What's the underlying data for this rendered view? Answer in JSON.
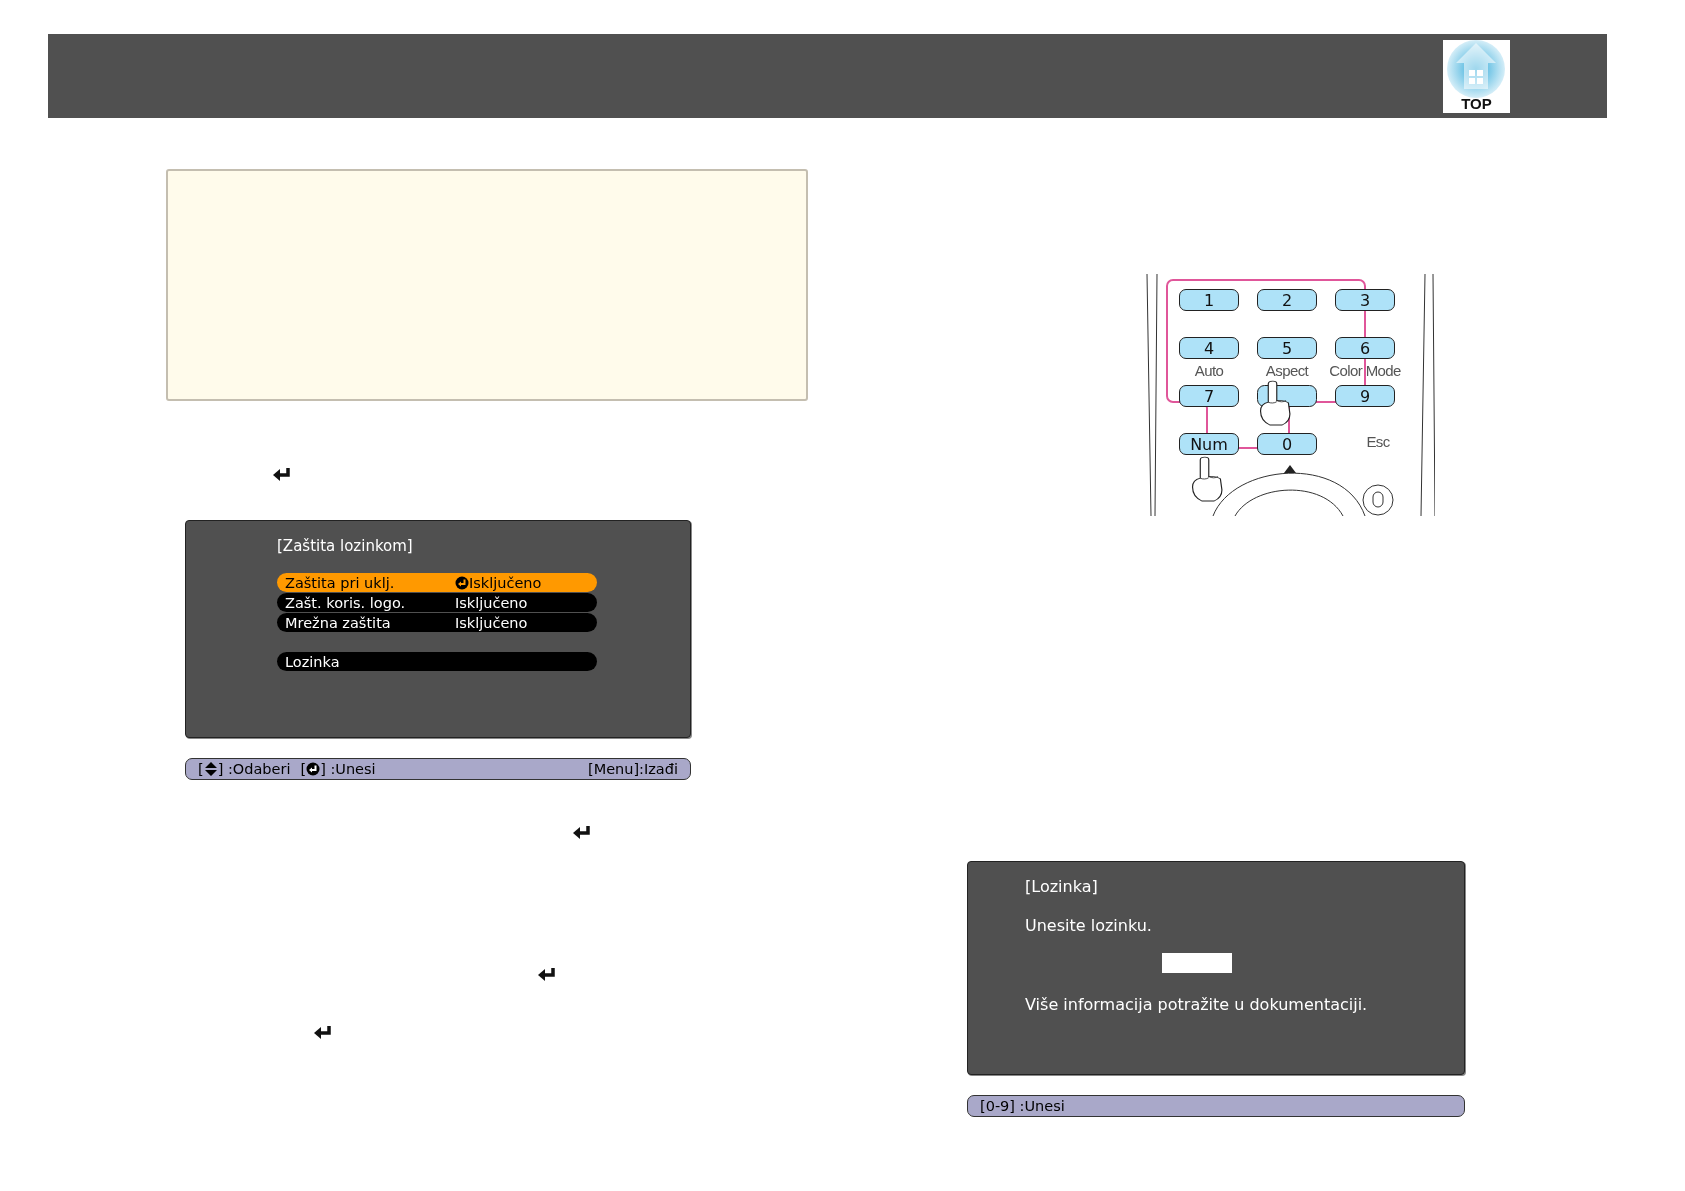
{
  "header": {
    "logo_text": "TOP"
  },
  "menu_screen": {
    "title": "[Zaštita lozinkom]",
    "items": [
      {
        "label": "Zaštita pri uklj.",
        "value": "Isključeno",
        "selected": true
      },
      {
        "label": "Zašt. koris. logo.",
        "value": "Isključeno",
        "selected": false
      },
      {
        "label": "Mrežna zaštita",
        "value": "Isključeno",
        "selected": false
      },
      {
        "label": "Lozinka",
        "selected": false
      }
    ],
    "help_bar": {
      "items": [
        {
          "kind": "updown",
          "before": "[",
          "after": "] :Odaberi"
        },
        {
          "kind": "enter",
          "before": "[",
          "after": "] :Unesi"
        }
      ],
      "right": "[Menu]:Izađi"
    }
  },
  "remote": {
    "keys": [
      {
        "label": "1"
      },
      {
        "label": "2"
      },
      {
        "label": "3"
      },
      {
        "label": "4"
      },
      {
        "label": "5"
      },
      {
        "label": "6"
      },
      {
        "label": "7"
      },
      {
        "label": "9"
      },
      {
        "label": "Num"
      },
      {
        "label": "0"
      }
    ],
    "key_captions": [
      "Auto",
      "Aspect",
      "Color Mode"
    ],
    "esc_label": "Esc"
  },
  "password_screen": {
    "title": "[Lozinka]",
    "prompt": "Unesite lozinku.",
    "info": "Više informacija potražite u dokumentaciji.",
    "help_bar": "[0-9] :Unesi"
  }
}
